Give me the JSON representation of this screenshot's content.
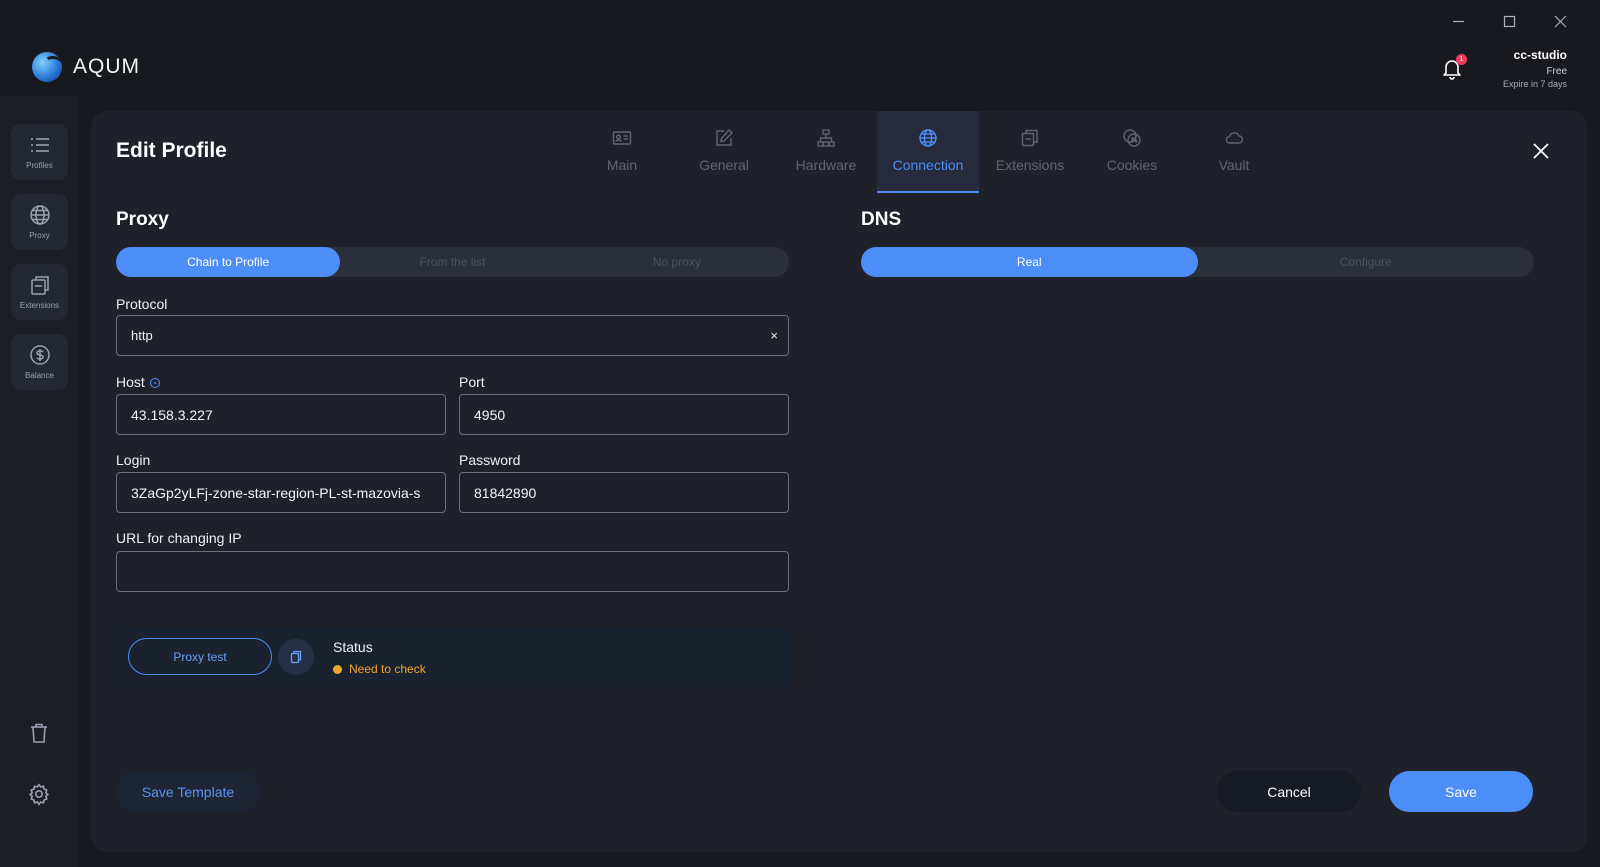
{
  "app": {
    "name": "AQUM"
  },
  "user": {
    "name": "cc-studio",
    "plan": "Free",
    "expire": "Expire in 7 days",
    "notifications": "1"
  },
  "sidebar": {
    "items": [
      {
        "label": "Profiles",
        "icon": "list-icon"
      },
      {
        "label": "Proxy",
        "icon": "globe-icon"
      },
      {
        "label": "Extensions",
        "icon": "extensions-icon"
      },
      {
        "label": "Balance",
        "icon": "dollar-icon"
      }
    ],
    "bottom": [
      {
        "icon": "trash-icon"
      },
      {
        "icon": "gear-icon"
      }
    ]
  },
  "panel": {
    "title": "Edit Profile",
    "tabs": [
      {
        "label": "Main",
        "icon": "id-card-icon",
        "active": false
      },
      {
        "label": "General",
        "icon": "edit-icon",
        "active": false
      },
      {
        "label": "Hardware",
        "icon": "hardware-icon",
        "active": false
      },
      {
        "label": "Connection",
        "icon": "globe-icon",
        "active": true
      },
      {
        "label": "Extensions",
        "icon": "extensions-icon",
        "active": false
      },
      {
        "label": "Cookies",
        "icon": "cookie-icon",
        "active": false
      },
      {
        "label": "Vault",
        "icon": "cloud-icon",
        "active": false
      }
    ]
  },
  "proxy": {
    "title": "Proxy",
    "modes": [
      "Chain to Profile",
      "From the list",
      "No proxy"
    ],
    "active_mode": "Chain to Profile",
    "protocol_label": "Protocol",
    "protocol_value": "http",
    "host_label": "Host",
    "host_value": "43.158.3.227",
    "port_label": "Port",
    "port_value": "4950",
    "login_label": "Login",
    "login_value": "3ZaGp2yLFj-zone-star-region-PL-st-mazovia-s",
    "password_label": "Password",
    "password_value": "81842890",
    "url_label": "URL for changing IP",
    "url_value": "",
    "test_label": "Proxy test",
    "status_title": "Status",
    "status_text": "Need to check"
  },
  "dns": {
    "title": "DNS",
    "modes": [
      "Real",
      "Configure"
    ],
    "active_mode": "Real"
  },
  "footer": {
    "save_template": "Save Template",
    "cancel": "Cancel",
    "save": "Save"
  },
  "colors": {
    "accent": "#4d8df7",
    "warning": "#f0a72d",
    "badge": "#ef3b5a"
  }
}
